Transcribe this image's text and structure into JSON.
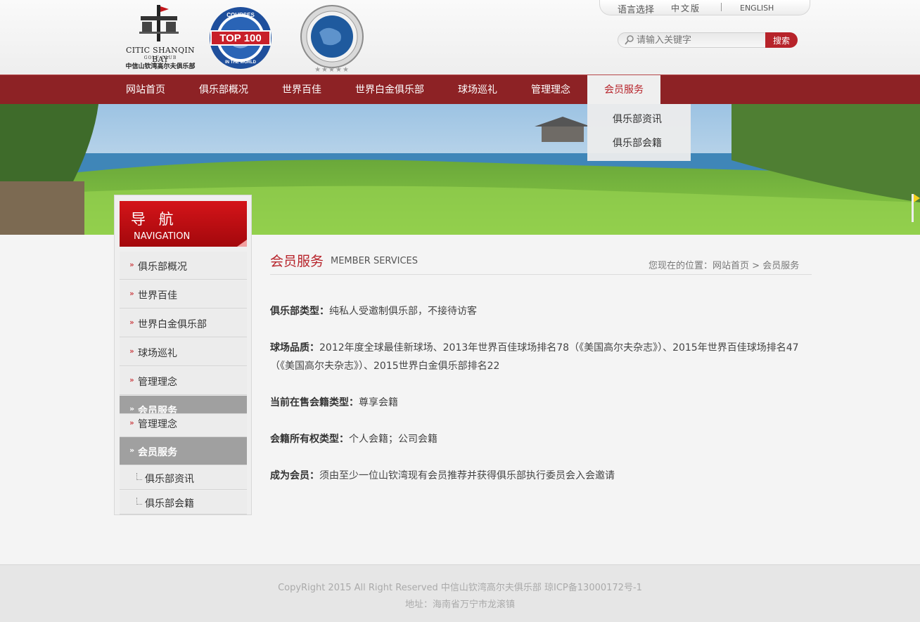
{
  "header": {
    "logo_name": "CITIC SHANQIN BAY",
    "logo_sub": "GOLF CLUB",
    "logo_cn": "中信山钦湾高尔夫俱乐部",
    "top100_text": "TOP 100",
    "top100_ring_top": "COURSES",
    "top100_ring_bottom": "IN THE WORLD",
    "platinum_ring": "PLATINUM CLUBS OF THE WORLD · 5 STAR PRIVATE CLUB",
    "language_label": "语言选择",
    "language_cn": "中文版",
    "language_en": "ENGLISH",
    "search_placeholder": "请输入关键字",
    "search_button": "搜索"
  },
  "nav": {
    "items": [
      {
        "label": "网站首页"
      },
      {
        "label": "俱乐部概况"
      },
      {
        "label": "世界百佳"
      },
      {
        "label": "世界白金俱乐部"
      },
      {
        "label": "球场巡礼"
      },
      {
        "label": "管理理念"
      },
      {
        "label": "会员服务"
      }
    ],
    "dropdown": [
      {
        "label": "俱乐部资讯"
      },
      {
        "label": "俱乐部会籍"
      }
    ]
  },
  "sidebar": {
    "title_cn": "导 航",
    "title_en": "NAVIGATION",
    "items": [
      {
        "label": "俱乐部概况"
      },
      {
        "label": "世界百佳"
      },
      {
        "label": "世界白金俱乐部"
      },
      {
        "label": "球场巡礼"
      },
      {
        "label": "管理理念"
      },
      {
        "label": "会员服务"
      },
      {
        "label": "管理理念"
      },
      {
        "label": "会员服务"
      }
    ],
    "subitems": [
      {
        "label": "俱乐部资讯"
      },
      {
        "label": "俱乐部会籍"
      }
    ]
  },
  "content": {
    "title": "会员服务",
    "title_en": "MEMBER SERVICES",
    "breadcrumb_prefix": "您现在的位置：",
    "breadcrumb_home": "网站首页",
    "breadcrumb_sep": " > ",
    "breadcrumb_current": "会员服务",
    "paragraphs": [
      {
        "label": "俱乐部类型：",
        "text": "纯私人受邀制俱乐部，不接待访客"
      },
      {
        "label": "球场品质：",
        "text": "2012年度全球最佳新球场、2013年世界百佳球场排名78（《美国高尔夫杂志》）、2015年世界百佳球场排名47（《美国高尔夫杂志》）、2015世界白金俱乐部排名22"
      },
      {
        "label": "当前在售会籍类型：",
        "text": "尊享会籍"
      },
      {
        "label": "会籍所有权类型：",
        "text": "个人会籍；公司会籍"
      },
      {
        "label": "成为会员：",
        "text": "须由至少一位山钦湾现有会员推荐并获得俱乐部执行委员会入会邀请"
      }
    ]
  },
  "footer": {
    "line1": "CopyRight 2015 All Right Reserved 中信山钦湾高尔夫俱乐部 琼ICP备13000172号-1",
    "line2": "地址：海南省万宁市龙滚镇"
  },
  "colors": {
    "nav_bg": "#8d2225",
    "accent": "#b7232a",
    "sidebar_active": "#a0a0a0"
  }
}
